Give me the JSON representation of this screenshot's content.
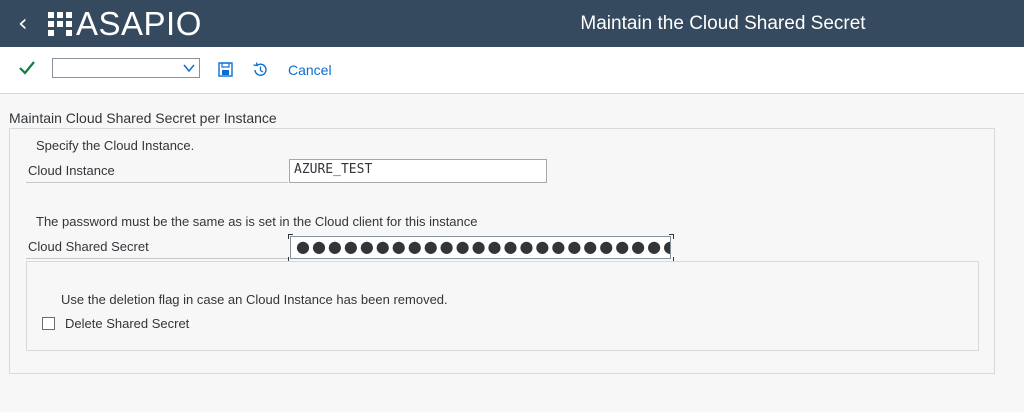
{
  "shell": {
    "brand": "ASAPIO",
    "title": "Maintain the Cloud Shared Secret"
  },
  "toolbar": {
    "command_field_value": "",
    "cancel_label": "Cancel"
  },
  "form": {
    "section_title": "Maintain Cloud Shared Secret per Instance",
    "instance_hint": "Specify the Cloud Instance.",
    "instance_label": "Cloud Instance",
    "instance_value": "AZURE_TEST",
    "secret_hint": "The password must be the same as is set in the Cloud client for this instance",
    "secret_label": "Cloud Shared Secret",
    "secret_value": "●●●●●●●●●●●●●●●●●●●●●●●●●",
    "deletion_hint": "Use the deletion flag in case an Cloud Instance has been removed.",
    "delete_label": "Delete Shared Secret",
    "delete_checked": false
  },
  "colors": {
    "shell_bg": "#354a5f",
    "accent": "#0a6ed1",
    "confirm": "#107e3e"
  },
  "icons": {
    "back": "chevron-left-icon",
    "confirm": "checkmark-icon",
    "dropdown": "chevron-down-icon",
    "save": "save-icon",
    "history": "history-icon"
  }
}
